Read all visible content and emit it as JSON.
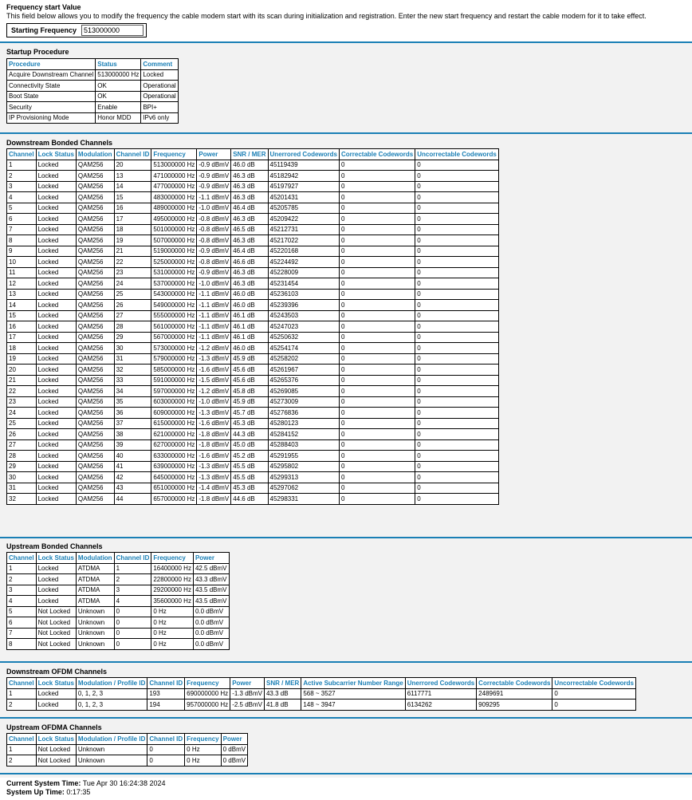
{
  "freq": {
    "title": "Frequency start Value",
    "description": "This field below allows you to modify the frequency the cable modem start with its scan during initialization and registration. Enter the new start frequency and restart the cable modem for it to take effect.",
    "label": "Starting Frequency",
    "value": "513000000"
  },
  "startup": {
    "title": "Startup Procedure",
    "headers": [
      "Procedure",
      "Status",
      "Comment"
    ],
    "rows": [
      [
        "Acquire Downstream Channel",
        "513000000 Hz",
        "Locked"
      ],
      [
        "Connectivity State",
        "OK",
        "Operational"
      ],
      [
        "Boot State",
        "OK",
        "Operational"
      ],
      [
        "Security",
        "Enable",
        "BPI+"
      ],
      [
        "IP Provisioning Mode",
        "Honor MDD",
        "IPv6 only"
      ]
    ]
  },
  "downstream": {
    "title": "Downstream Bonded Channels",
    "headers": [
      "Channel",
      "Lock Status",
      "Modulation",
      "Channel ID",
      "Frequency",
      "Power",
      "SNR / MER",
      "Unerrored Codewords",
      "Correctable Codewords",
      "Uncorrectable Codewords"
    ],
    "rows": [
      [
        "1",
        "Locked",
        "QAM256",
        "20",
        "513000000 Hz",
        "-0.9 dBmV",
        "46.0 dB",
        "45119439",
        "0",
        "0"
      ],
      [
        "2",
        "Locked",
        "QAM256",
        "13",
        "471000000 Hz",
        "-0.9 dBmV",
        "46.3 dB",
        "45182942",
        "0",
        "0"
      ],
      [
        "3",
        "Locked",
        "QAM256",
        "14",
        "477000000 Hz",
        "-0.9 dBmV",
        "46.3 dB",
        "45197927",
        "0",
        "0"
      ],
      [
        "4",
        "Locked",
        "QAM256",
        "15",
        "483000000 Hz",
        "-1.1 dBmV",
        "46.3 dB",
        "45201431",
        "0",
        "0"
      ],
      [
        "5",
        "Locked",
        "QAM256",
        "16",
        "489000000 Hz",
        "-1.0 dBmV",
        "46.4 dB",
        "45205785",
        "0",
        "0"
      ],
      [
        "6",
        "Locked",
        "QAM256",
        "17",
        "495000000 Hz",
        "-0.8 dBmV",
        "46.3 dB",
        "45209422",
        "0",
        "0"
      ],
      [
        "7",
        "Locked",
        "QAM256",
        "18",
        "501000000 Hz",
        "-0.8 dBmV",
        "46.5 dB",
        "45212731",
        "0",
        "0"
      ],
      [
        "8",
        "Locked",
        "QAM256",
        "19",
        "507000000 Hz",
        "-0.8 dBmV",
        "46.3 dB",
        "45217022",
        "0",
        "0"
      ],
      [
        "9",
        "Locked",
        "QAM256",
        "21",
        "519000000 Hz",
        "-0.9 dBmV",
        "46.4 dB",
        "45220168",
        "0",
        "0"
      ],
      [
        "10",
        "Locked",
        "QAM256",
        "22",
        "525000000 Hz",
        "-0.8 dBmV",
        "46.6 dB",
        "45224492",
        "0",
        "0"
      ],
      [
        "11",
        "Locked",
        "QAM256",
        "23",
        "531000000 Hz",
        "-0.9 dBmV",
        "46.3 dB",
        "45228009",
        "0",
        "0"
      ],
      [
        "12",
        "Locked",
        "QAM256",
        "24",
        "537000000 Hz",
        "-1.0 dBmV",
        "46.3 dB",
        "45231454",
        "0",
        "0"
      ],
      [
        "13",
        "Locked",
        "QAM256",
        "25",
        "543000000 Hz",
        "-1.1 dBmV",
        "46.0 dB",
        "45236103",
        "0",
        "0"
      ],
      [
        "14",
        "Locked",
        "QAM256",
        "26",
        "549000000 Hz",
        "-1.1 dBmV",
        "46.0 dB",
        "45239396",
        "0",
        "0"
      ],
      [
        "15",
        "Locked",
        "QAM256",
        "27",
        "555000000 Hz",
        "-1.1 dBmV",
        "46.1 dB",
        "45243503",
        "0",
        "0"
      ],
      [
        "16",
        "Locked",
        "QAM256",
        "28",
        "561000000 Hz",
        "-1.1 dBmV",
        "46.1 dB",
        "45247023",
        "0",
        "0"
      ],
      [
        "17",
        "Locked",
        "QAM256",
        "29",
        "567000000 Hz",
        "-1.1 dBmV",
        "46.1 dB",
        "45250632",
        "0",
        "0"
      ],
      [
        "18",
        "Locked",
        "QAM256",
        "30",
        "573000000 Hz",
        "-1.2 dBmV",
        "46.0 dB",
        "45254174",
        "0",
        "0"
      ],
      [
        "19",
        "Locked",
        "QAM256",
        "31",
        "579000000 Hz",
        "-1.3 dBmV",
        "45.9 dB",
        "45258202",
        "0",
        "0"
      ],
      [
        "20",
        "Locked",
        "QAM256",
        "32",
        "585000000 Hz",
        "-1.6 dBmV",
        "45.6 dB",
        "45261967",
        "0",
        "0"
      ],
      [
        "21",
        "Locked",
        "QAM256",
        "33",
        "591000000 Hz",
        "-1.5 dBmV",
        "45.6 dB",
        "45265376",
        "0",
        "0"
      ],
      [
        "22",
        "Locked",
        "QAM256",
        "34",
        "597000000 Hz",
        "-1.2 dBmV",
        "45.8 dB",
        "45269085",
        "0",
        "0"
      ],
      [
        "23",
        "Locked",
        "QAM256",
        "35",
        "603000000 Hz",
        "-1.0 dBmV",
        "45.9 dB",
        "45273009",
        "0",
        "0"
      ],
      [
        "24",
        "Locked",
        "QAM256",
        "36",
        "609000000 Hz",
        "-1.3 dBmV",
        "45.7 dB",
        "45276836",
        "0",
        "0"
      ],
      [
        "25",
        "Locked",
        "QAM256",
        "37",
        "615000000 Hz",
        "-1.6 dBmV",
        "45.3 dB",
        "45280123",
        "0",
        "0"
      ],
      [
        "26",
        "Locked",
        "QAM256",
        "38",
        "621000000 Hz",
        "-1.8 dBmV",
        "44.3 dB",
        "45284152",
        "0",
        "0"
      ],
      [
        "27",
        "Locked",
        "QAM256",
        "39",
        "627000000 Hz",
        "-1.8 dBmV",
        "45.0 dB",
        "45288403",
        "0",
        "0"
      ],
      [
        "28",
        "Locked",
        "QAM256",
        "40",
        "633000000 Hz",
        "-1.6 dBmV",
        "45.2 dB",
        "45291955",
        "0",
        "0"
      ],
      [
        "29",
        "Locked",
        "QAM256",
        "41",
        "639000000 Hz",
        "-1.3 dBmV",
        "45.5 dB",
        "45295802",
        "0",
        "0"
      ],
      [
        "30",
        "Locked",
        "QAM256",
        "42",
        "645000000 Hz",
        "-1.3 dBmV",
        "45.5 dB",
        "45299313",
        "0",
        "0"
      ],
      [
        "31",
        "Locked",
        "QAM256",
        "43",
        "651000000 Hz",
        "-1.4 dBmV",
        "45.3 dB",
        "45297062",
        "0",
        "0"
      ],
      [
        "32",
        "Locked",
        "QAM256",
        "44",
        "657000000 Hz",
        "-1.8 dBmV",
        "44.6 dB",
        "45298331",
        "0",
        "0"
      ]
    ]
  },
  "upstream": {
    "title": "Upstream Bonded Channels",
    "headers": [
      "Channel",
      "Lock Status",
      "Modulation",
      "Channel ID",
      "Frequency",
      "Power"
    ],
    "rows": [
      [
        "1",
        "Locked",
        "ATDMA",
        "1",
        "16400000 Hz",
        "42.5 dBmV"
      ],
      [
        "2",
        "Locked",
        "ATDMA",
        "2",
        "22800000 Hz",
        "43.3 dBmV"
      ],
      [
        "3",
        "Locked",
        "ATDMA",
        "3",
        "29200000 Hz",
        "43.5 dBmV"
      ],
      [
        "4",
        "Locked",
        "ATDMA",
        "4",
        "35600000 Hz",
        "43.5 dBmV"
      ],
      [
        "5",
        "Not Locked",
        "Unknown",
        "0",
        "0 Hz",
        "0.0 dBmV"
      ],
      [
        "6",
        "Not Locked",
        "Unknown",
        "0",
        "0 Hz",
        "0.0 dBmV"
      ],
      [
        "7",
        "Not Locked",
        "Unknown",
        "0",
        "0 Hz",
        "0.0 dBmV"
      ],
      [
        "8",
        "Not Locked",
        "Unknown",
        "0",
        "0 Hz",
        "0.0 dBmV"
      ]
    ]
  },
  "ofdm": {
    "title": "Downstream OFDM Channels",
    "headers": [
      "Channel",
      "Lock Status",
      "Modulation / Profile ID",
      "Channel ID",
      "Frequency",
      "Power",
      "SNR / MER",
      "Active Subcarrier Number Range",
      "Unerrored Codewords",
      "Correctable Codewords",
      "Uncorrectable Codewords"
    ],
    "rows": [
      [
        "1",
        "Locked",
        "0, 1, 2, 3",
        "193",
        "690000000 Hz",
        "-1.3 dBmV",
        "43.3 dB",
        "568 ~ 3527",
        "6117771",
        "2489691",
        "0"
      ],
      [
        "2",
        "Locked",
        "0, 1, 2, 3",
        "194",
        "957000000 Hz",
        "-2.5 dBmV",
        "41.8 dB",
        "148 ~ 3947",
        "6134262",
        "909295",
        "0"
      ]
    ]
  },
  "ofdma": {
    "title": "Upstream OFDMA Channels",
    "headers": [
      "Channel",
      "Lock Status",
      "Modulation / Profile ID",
      "Channel ID",
      "Frequency",
      "Power"
    ],
    "rows": [
      [
        "1",
        "Not Locked",
        "Unknown",
        "0",
        "0 Hz",
        "0 dBmV"
      ],
      [
        "2",
        "Not Locked",
        "Unknown",
        "0",
        "0 Hz",
        "0 dBmV"
      ]
    ]
  },
  "footer": {
    "time_label": "Current System Time:",
    "time_value": "Tue Apr 30 16:24:38 2024",
    "uptime_label": "System Up Time:",
    "uptime_value": "0:17:35"
  },
  "colors": {
    "header_text": "#1a7fb5",
    "separator": "#1a7fb5",
    "section_bg": "#f2f2f2"
  }
}
